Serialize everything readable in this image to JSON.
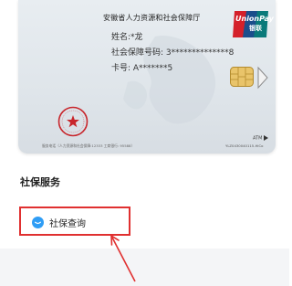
{
  "card": {
    "issuer": "安徽省人力资源和社会保障厅",
    "unionpay_en": "UnionPay",
    "unionpay_cn": "银联",
    "name_line": "姓名:*龙",
    "ssn_line": "社会保障号码: 3**************8",
    "cardno_line": "卡号: A*******5",
    "footer_left": "服务电话（人力资源和社会保障:12333 工商银行: 95588）",
    "atm": "ATM",
    "serial": "YLZ0430040115-HiCo",
    "seal_icon": "official-seal-icon",
    "chip_icon": "chip-icon",
    "seal_color": "#c8262c"
  },
  "section": {
    "title": "社保服务"
  },
  "menu": {
    "items": [
      {
        "label": "社保查询",
        "icon": "chat-bubble-icon",
        "highlight_color": "#e03030"
      }
    ]
  },
  "colors": {
    "accent": "#2f9df5",
    "highlight": "#e03030",
    "unionpay_red": "#d4202a",
    "unionpay_blue": "#1b4e8c",
    "unionpay_teal": "#0a7a7a"
  }
}
